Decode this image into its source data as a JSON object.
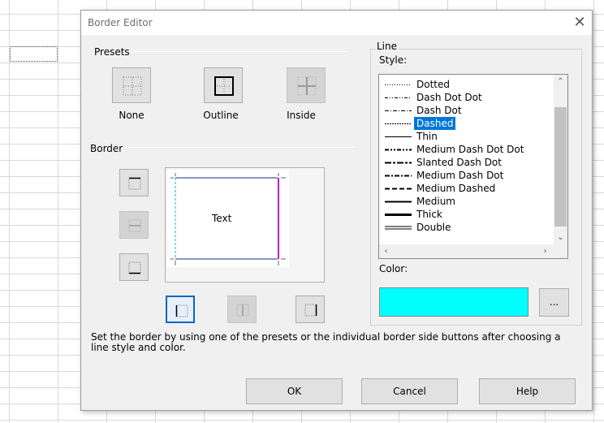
{
  "dialog": {
    "title": "Border Editor"
  },
  "presets": {
    "group_label": "Presets",
    "none_label": "None",
    "outline_label": "Outline",
    "inside_label": "Inside"
  },
  "border": {
    "group_label": "Border",
    "preview_text": "Text"
  },
  "line": {
    "group_label": "Line",
    "style_label": "Style:",
    "styles": [
      {
        "label": "Dotted",
        "pattern": "dotted"
      },
      {
        "label": "Dash Dot Dot",
        "pattern": "dash-dot-dot"
      },
      {
        "label": "Dash Dot",
        "pattern": "dash-dot"
      },
      {
        "label": "Dashed",
        "pattern": "dashed",
        "selected": true
      },
      {
        "label": "Thin",
        "pattern": "thin"
      },
      {
        "label": "Medium Dash Dot Dot",
        "pattern": "medium-dash-dot-dot"
      },
      {
        "label": "Slanted Dash Dot",
        "pattern": "slanted-dash-dot"
      },
      {
        "label": "Medium Dash Dot",
        "pattern": "medium-dash-dot"
      },
      {
        "label": "Medium Dashed",
        "pattern": "medium-dashed"
      },
      {
        "label": "Medium",
        "pattern": "medium"
      },
      {
        "label": "Thick",
        "pattern": "thick"
      },
      {
        "label": "Double",
        "pattern": "double"
      }
    ],
    "color_label": "Color:",
    "color_value": "#00ffff",
    "more_colors_label": "..."
  },
  "description": "Set the border by using one of the presets or the individual border side buttons after choosing a line style and color.",
  "buttons": {
    "ok": "OK",
    "cancel": "Cancel",
    "help": "Help"
  },
  "colors": {
    "selection": "#0078d7",
    "preview_border": "#1f2b8f",
    "preview_right": "#c020c0",
    "preview_left": "#00bcd4"
  }
}
